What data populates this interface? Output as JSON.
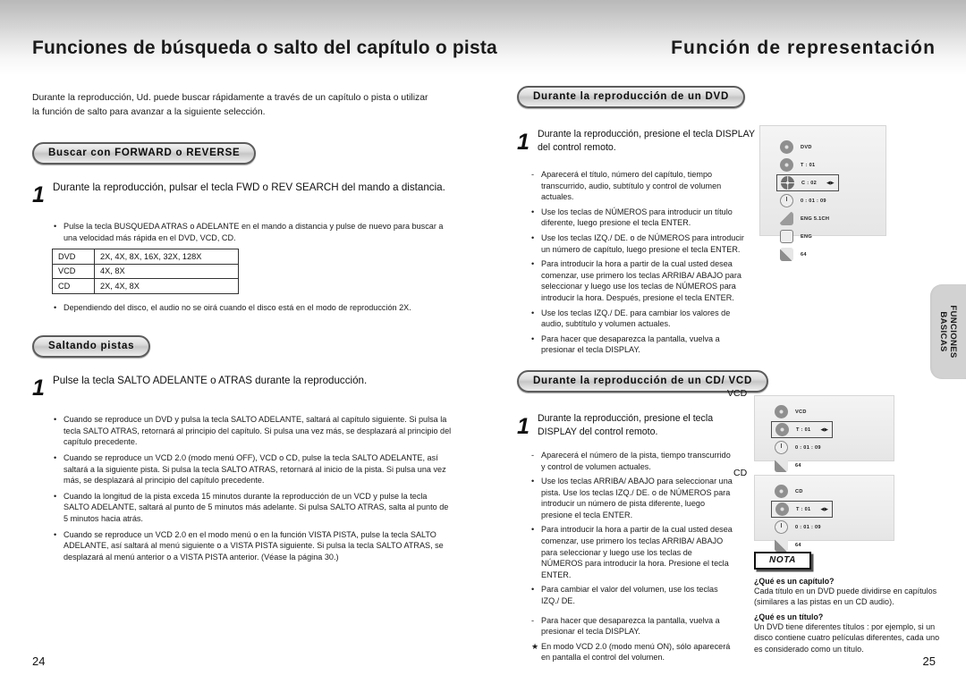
{
  "header": {
    "left_title": "Funciones de búsqueda o salto del capítulo o pista",
    "right_title": "Función de representación"
  },
  "left_page": {
    "intro": "Durante la reproducción, Ud. puede buscar rápidamente a través de un capítulo o pista o utilizar la función de salto para avanzar a la siguiente selección.",
    "section1": {
      "pill": "Buscar con FORWARD o REVERSE",
      "step_number": "1",
      "step_text": "Durante la reproducción, pulsar el tecla FWD o REV SEARCH del mando a distancia.",
      "bullets_before_table": [
        "Pulse la tecla BUSQUEDA ATRAS o ADELANTE en el mando a distancia y pulse de nuevo para buscar a una velocidad más rápida en el DVD, VCD, CD."
      ],
      "table": {
        "rows": [
          {
            "disc": "DVD",
            "speeds": "2X, 4X, 8X, 16X, 32X, 128X"
          },
          {
            "disc": "VCD",
            "speeds": "4X, 8X"
          },
          {
            "disc": "CD",
            "speeds": "2X, 4X, 8X"
          }
        ]
      },
      "bullets_after_table": [
        "Dependiendo del disco, el audio no se oirá cuando el disco está en el modo de reproducción 2X."
      ]
    },
    "section2": {
      "pill": "Saltando pistas",
      "step_number": "1",
      "step_text": "Pulse la tecla SALTO ADELANTE o ATRAS durante la reproducción.",
      "bullets": [
        "Cuando se reproduce un DVD y pulsa la tecla SALTO ADELANTE, saltará al capítulo siguiente. Si pulsa la tecla SALTO ATRAS, retornará al principio del capítulo. Si pulsa una vez más, se desplazará al principio del capítulo precedente.",
        "Cuando se reproduce un VCD 2.0 (modo menú OFF), VCD o CD, pulse la tecla SALTO ADELANTE, así saltará a la siguiente pista. Si pulsa la tecla SALTO ATRAS, retornará al inicio de la pista. Si pulsa una vez más, se desplazará al principio del capítulo precedente.",
        "Cuando la longitud de la pista exceda 15 minutos durante la reproducción de un VCD y pulse la tecla SALTO ADELANTE, saltará al punto de 5 minutos más adelante. Si pulsa SALTO ATRAS, salta al punto de 5 minutos hacia atrás.",
        "Cuando se reproduce un VCD 2.0 en el modo menú o en la función VISTA PISTA, pulse la tecla SALTO ADELANTE, así saltará al menú siguiente o a VISTA PISTA siguiente. Si pulsa la tecla SALTO ATRAS, se desplazará al menú anterior o a VISTA PISTA anterior. (Véase la página 30.)"
      ]
    },
    "page_number": "24"
  },
  "right_page": {
    "section_dvd": {
      "pill": "Durante la reproducción de un DVD",
      "step_number": "1",
      "step_text": "Durante la reproducción, presione el tecla DISPLAY del control remoto.",
      "bullets": [
        {
          "mark": "-",
          "text": "Aparecerá el título, número del capítulo, tiempo transcurrido, audio, subtítulo y control de volumen actuales."
        },
        {
          "mark": "•",
          "text": "Use los teclas de NÚMEROS para introducir un título diferente, luego presione el tecla ENTER."
        },
        {
          "mark": "•",
          "text": "Use los teclas IZQ./ DE. o de NÚMEROS para introducir un número de capítulo, luego presione el tecla ENTER."
        },
        {
          "mark": "•",
          "text": "Para introducir la hora a partir de la cual usted desea comenzar, use primero los teclas ARRIBA/ ABAJO para seleccionar y luego use los teclas de NÚMEROS para introducir la hora. Después, presione el tecla ENTER."
        },
        {
          "mark": "•",
          "text": "Use los teclas IZQ./ DE. para cambiar los valores de audio, subtítulo y volumen actuales."
        },
        {
          "mark": "•",
          "text": "Para hacer que desaparezca la pantalla, vuelva a presionar el tecla DISPLAY."
        }
      ],
      "osd": {
        "rows": [
          {
            "icon": "disc-icon",
            "value": "DVD",
            "highlight": false,
            "arrows": ""
          },
          {
            "icon": "title-icon",
            "value": "T : 01",
            "highlight": false,
            "arrows": ""
          },
          {
            "icon": "chapter-icon",
            "value": "C : 02",
            "highlight": true,
            "arrows": "◀▶"
          },
          {
            "icon": "clock-icon",
            "value": "0 : 01 : 09",
            "highlight": false,
            "arrows": ""
          },
          {
            "icon": "audio-icon",
            "value": "ENG 5.1CH",
            "highlight": false,
            "arrows": ""
          },
          {
            "icon": "subtitle-icon",
            "value": "ENG",
            "highlight": false,
            "arrows": ""
          },
          {
            "icon": "volume-icon",
            "value": "64",
            "highlight": false,
            "arrows": ""
          }
        ]
      }
    },
    "section_cdvcd": {
      "pill": "Durante la reproducción de un CD/ VCD",
      "step_number": "1",
      "step_text": "Durante la reproducción, presione el tecla DISPLAY del control remoto.",
      "bullets": [
        {
          "mark": "-",
          "text": "Aparecerá el número de la pista, tiempo transcurrido y control de volumen actuales."
        },
        {
          "mark": "•",
          "text": "Use los teclas ARRIBA/ ABAJO para seleccionar una pista. Use los teclas IZQ./ DE. o de NÚMEROS para introducir un número de pista diferente, luego presione el tecla ENTER."
        },
        {
          "mark": "•",
          "text": "Para introducir la hora a partir de la cual usted desea comenzar, use primero los teclas ARRIBA/ ABAJO para seleccionar y luego use los teclas de NÚMEROS para introducir la hora. Presione el tecla ENTER."
        },
        {
          "mark": "•",
          "text": "Para cambiar el valor del volumen, use los teclas IZQ./ DE."
        },
        {
          "mark": "-",
          "text": "Para hacer que desaparezca la pantalla, vuelva a presionar el tecla DISPLAY."
        },
        {
          "mark": "★",
          "text": "En modo VCD 2.0  (modo menú ON), sólo aparecerá en pantalla el control del volumen."
        }
      ],
      "osd_vcd": {
        "label": "VCD",
        "rows": [
          {
            "icon": "disc-icon",
            "value": "VCD",
            "highlight": false,
            "arrows": ""
          },
          {
            "icon": "track-icon",
            "value": "T : 01",
            "highlight": true,
            "arrows": "◀▶"
          },
          {
            "icon": "clock-icon",
            "value": "0 : 01 : 09",
            "highlight": false,
            "arrows": ""
          },
          {
            "icon": "volume-icon",
            "value": "64",
            "highlight": false,
            "arrows": ""
          }
        ]
      },
      "osd_cd": {
        "label": "CD",
        "rows": [
          {
            "icon": "disc-icon",
            "value": "CD",
            "highlight": false,
            "arrows": ""
          },
          {
            "icon": "track-icon",
            "value": "T : 01",
            "highlight": true,
            "arrows": "◀▶"
          },
          {
            "icon": "clock-icon",
            "value": "0 : 01 : 09",
            "highlight": false,
            "arrows": ""
          },
          {
            "icon": "volume-icon",
            "value": "64",
            "highlight": false,
            "arrows": ""
          }
        ]
      }
    },
    "nota": {
      "badge": "NOTA",
      "q1": "¿Qué es un capítulo?",
      "a1": "Cada título en un DVD puede dividirse en capítulos (similares a las pistas en un CD audio).",
      "q2": "¿Qué es un título?",
      "a2": "Un DVD tiene diferentes títulos : por ejemplo, si un disco contiene cuatro películas diferentes, cada uno es considerado como un título."
    },
    "page_number": "25"
  },
  "side_tab": {
    "line1": "FUNCIONES",
    "line2": "BASICAS"
  }
}
